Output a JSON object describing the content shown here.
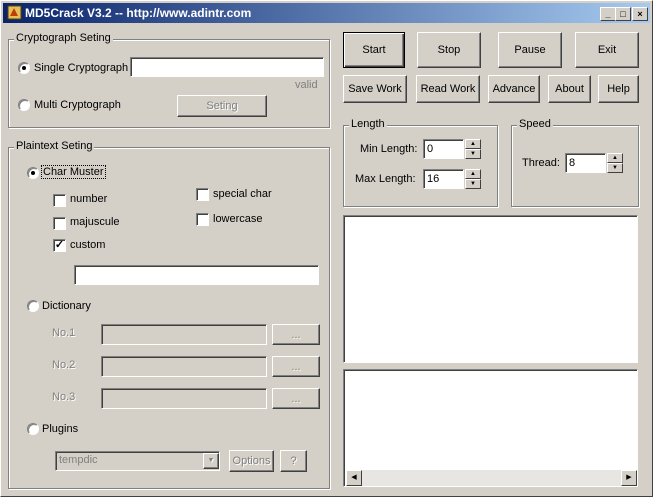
{
  "window": {
    "title": "MD5Crack V3.2 -- http://www.adintr.com"
  },
  "titlebar": {
    "minimize": "_",
    "maximize": "□",
    "close": "×"
  },
  "crypto": {
    "group_label": "Cryptograph Seting",
    "single_label": "Single Cryptograph",
    "single_value": "",
    "valid_text": "valid",
    "multi_label": "Multi Cryptograph",
    "seting_button": "Seting"
  },
  "plaintext": {
    "group_label": "Plaintext Seting",
    "char_muster_label": "Char Muster",
    "number_label": "number",
    "special_label": "special char",
    "majuscule_label": "majuscule",
    "lowercase_label": "lowercase",
    "custom_label": "custom",
    "custom_checked": "✓",
    "custom_value": "",
    "dictionary_label": "Dictionary",
    "dicts": [
      {
        "label": "No.1",
        "browse": "..."
      },
      {
        "label": "No.2",
        "browse": "..."
      },
      {
        "label": "No.3",
        "browse": "..."
      }
    ],
    "plugins_label": "Plugins",
    "plugin_select": "tempdic",
    "options_button": "Options",
    "help_button": "?"
  },
  "buttons": {
    "start": "Start",
    "stop": "Stop",
    "pause": "Pause",
    "exit": "Exit",
    "save_work": "Save Work",
    "read_work": "Read Work",
    "advance": "Advance",
    "about": "About",
    "help": "Help"
  },
  "length": {
    "group_label": "Length",
    "min_label": "Min Length:",
    "min_value": "0",
    "max_label": "Max Length:",
    "max_value": "16"
  },
  "speed": {
    "group_label": "Speed",
    "thread_label": "Thread:",
    "thread_value": "8"
  },
  "icons": {
    "spin_up": "▲",
    "spin_down": "▼",
    "combo_arrow": "▼",
    "scroll_left": "◀",
    "scroll_right": "▶"
  }
}
